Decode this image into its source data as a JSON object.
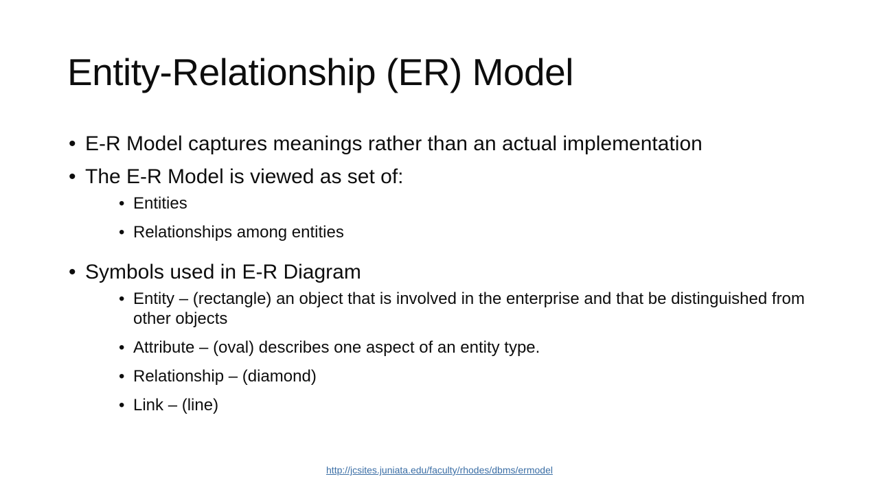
{
  "slide": {
    "title": "Entity-Relationship (ER) Model",
    "background_color": "#ffffff",
    "text_color": "#0d0d0d",
    "bullet_glyph": "•",
    "content": [
      {
        "level": 1,
        "text": "E-R Model captures meanings rather than an actual implementation"
      },
      {
        "level": 1,
        "text": "The E-R Model is viewed as set of:",
        "children": [
          {
            "level": 2,
            "text": "Entities"
          },
          {
            "level": 2,
            "text": "Relationships among entities"
          }
        ]
      },
      {
        "level": 1,
        "text": "Symbols used in E-R Diagram",
        "children": [
          {
            "level": 2,
            "text": "Entity – (rectangle) an object that is involved in the enterprise and that be distinguished from other objects"
          },
          {
            "level": 2,
            "text": "Attribute – (oval) describes one aspect of an entity type."
          },
          {
            "level": 2,
            "text": "Relationship – (diamond)"
          },
          {
            "level": 2,
            "text": "Link – (line)"
          }
        ]
      }
    ],
    "footer": {
      "link_text": "http://jcsites.juniata.edu/faculty/rhodes/dbms/ermodel",
      "link_color": "#3b6ea5"
    }
  }
}
